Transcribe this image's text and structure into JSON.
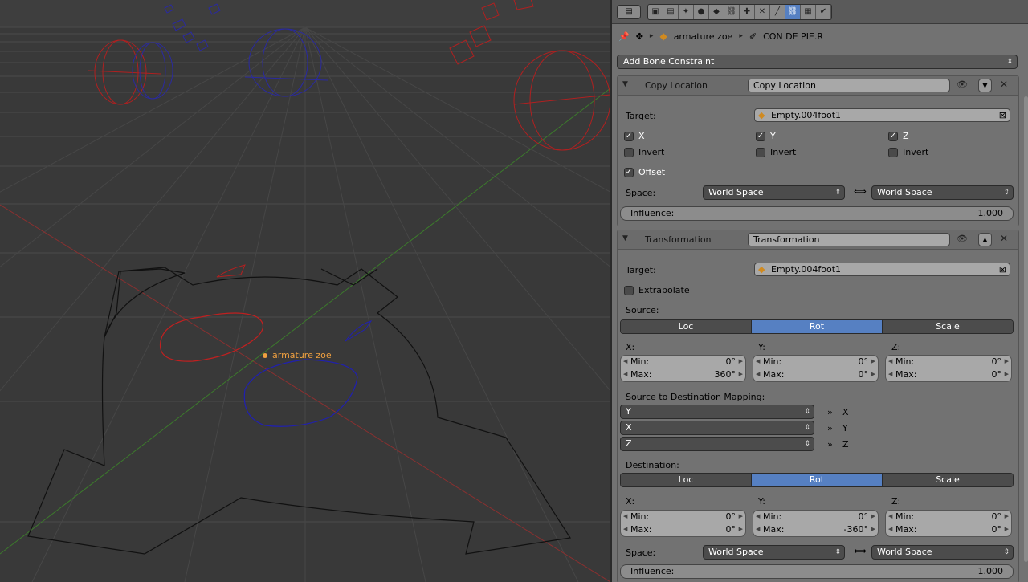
{
  "viewport": {
    "object_label": "armature zoe"
  },
  "header": {
    "editor_menu": "▤",
    "context_tabs": [
      "render",
      "layers",
      "scene",
      "world",
      "object",
      "constraints",
      "modifiers",
      "data",
      "bone",
      "bone-constraints",
      "material",
      "texture"
    ]
  },
  "breadcrumb": {
    "items": [
      "armature zoe",
      "CON DE PIE.R"
    ]
  },
  "add_constraint": {
    "label": "Add Bone Constraint"
  },
  "copy_location": {
    "title": "Copy Location",
    "name_value": "Copy Location",
    "target_label": "Target:",
    "target_value": "Empty.004foot1",
    "axes": [
      {
        "label": "X",
        "checked": true,
        "invert_label": "Invert"
      },
      {
        "label": "Y",
        "checked": true,
        "invert_label": "Invert"
      },
      {
        "label": "Z",
        "checked": true,
        "invert_label": "Invert"
      }
    ],
    "offset_label": "Offset",
    "space_label": "Space:",
    "owner_space": "World Space",
    "target_space": "World Space",
    "influence_label": "Influence:",
    "influence_value": "1.000"
  },
  "transformation": {
    "title": "Transformation",
    "name_value": "Transformation",
    "target_label": "Target:",
    "target_value": "Empty.004foot1",
    "extrapolate_label": "Extrapolate",
    "source_label": "Source:",
    "source_modes": [
      "Loc",
      "Rot",
      "Scale"
    ],
    "source_active": "Rot",
    "source_axes": [
      {
        "axis": "X:",
        "min": "0°",
        "max": "360°"
      },
      {
        "axis": "Y:",
        "min": "0°",
        "max": "0°"
      },
      {
        "axis": "Z:",
        "min": "0°",
        "max": "0°"
      }
    ],
    "min_label": "Min:",
    "max_label": "Max:",
    "mapping_label": "Source to Destination Mapping:",
    "mapping": [
      {
        "from": "Y",
        "to": "X"
      },
      {
        "from": "X",
        "to": "Y"
      },
      {
        "from": "Z",
        "to": "Z"
      }
    ],
    "destination_label": "Destination:",
    "dest_modes": [
      "Loc",
      "Rot",
      "Scale"
    ],
    "dest_active": "Rot",
    "dest_axes": [
      {
        "axis": "X:",
        "min": "0°",
        "max": "0°"
      },
      {
        "axis": "Y:",
        "min": "0°",
        "max": "-360°"
      },
      {
        "axis": "Z:",
        "min": "0°",
        "max": "0°"
      }
    ],
    "space_label": "Space:",
    "owner_space": "World Space",
    "target_space": "World Space",
    "influence_label": "Influence:",
    "influence_value": "1.000"
  }
}
